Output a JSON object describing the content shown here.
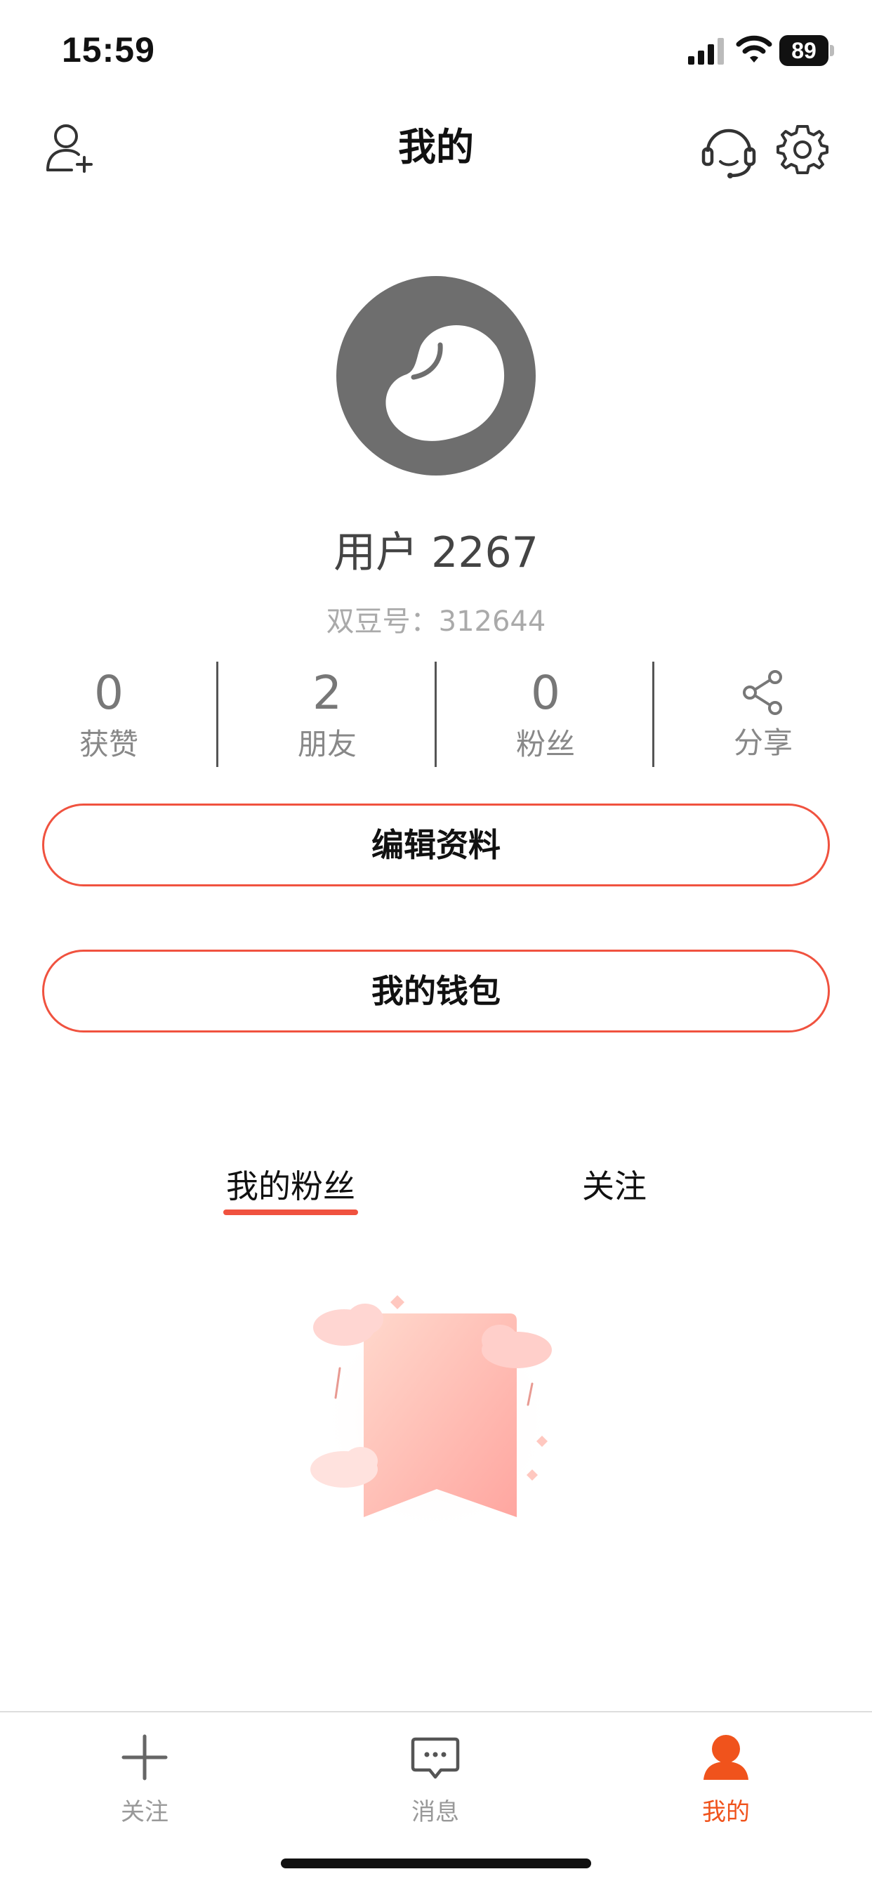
{
  "status_bar": {
    "time": "15:59",
    "battery": "89",
    "icons": [
      "signal-icon",
      "wifi-icon",
      "battery-icon"
    ]
  },
  "header": {
    "title": "我的",
    "icons": [
      "add-user-icon",
      "customer-service-icon",
      "gear-icon"
    ]
  },
  "profile": {
    "avatar_icon": "bean-avatar",
    "username": "用户 2267",
    "id_line": "双豆号：312644"
  },
  "stats": [
    {
      "value": "0",
      "label": "获赞"
    },
    {
      "value": "2",
      "label": "朋友"
    },
    {
      "value": "0",
      "label": "粉丝"
    }
  ],
  "share": {
    "label": "分享",
    "icon": "share-icon"
  },
  "buttons": {
    "edit_profile": "编辑资料",
    "wallet": "我的钱包"
  },
  "tabs": {
    "fans": "我的粉丝",
    "following": "关注",
    "active": "fans"
  },
  "bottom_nav": {
    "items": [
      {
        "label": "关注",
        "icon": "plus-icon"
      },
      {
        "label": "消息",
        "icon": "message-icon"
      },
      {
        "label": "我的",
        "icon": "user-icon",
        "active": true
      }
    ]
  },
  "colors": {
    "accent": "#f0523f",
    "active_nav": "#f0531c",
    "avatar_bg": "#6e6e6e"
  }
}
